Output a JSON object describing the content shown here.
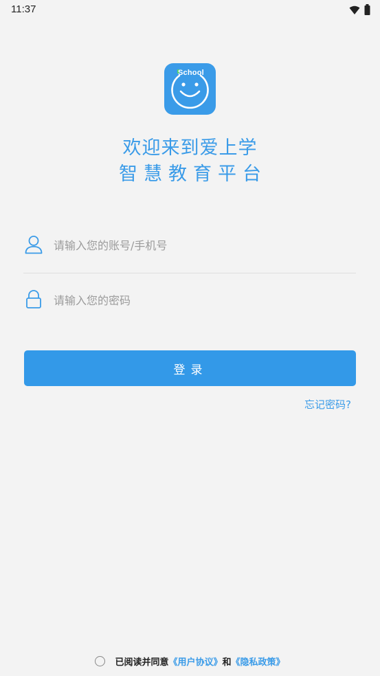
{
  "status_bar": {
    "time": "11:37",
    "icons": [
      "wifi-icon",
      "battery-icon"
    ]
  },
  "logo": {
    "text": "School",
    "icon": "smiley-face-icon"
  },
  "title": {
    "line1": "欢迎来到爱上学",
    "line2": "智慧教育平台"
  },
  "form": {
    "account_placeholder": "请输入您的账号/手机号",
    "password_placeholder": "请输入您的密码",
    "login_label": "登录",
    "forgot_label": "忘记密码?"
  },
  "agreement": {
    "prefix": "已阅读并同意",
    "user_agreement": "《用户协议》",
    "conjunction": "和",
    "privacy_policy": "《隐私政策》"
  },
  "colors": {
    "accent": "#3a9be8",
    "background": "#f3f3f3",
    "placeholder": "#9b9b9b"
  }
}
